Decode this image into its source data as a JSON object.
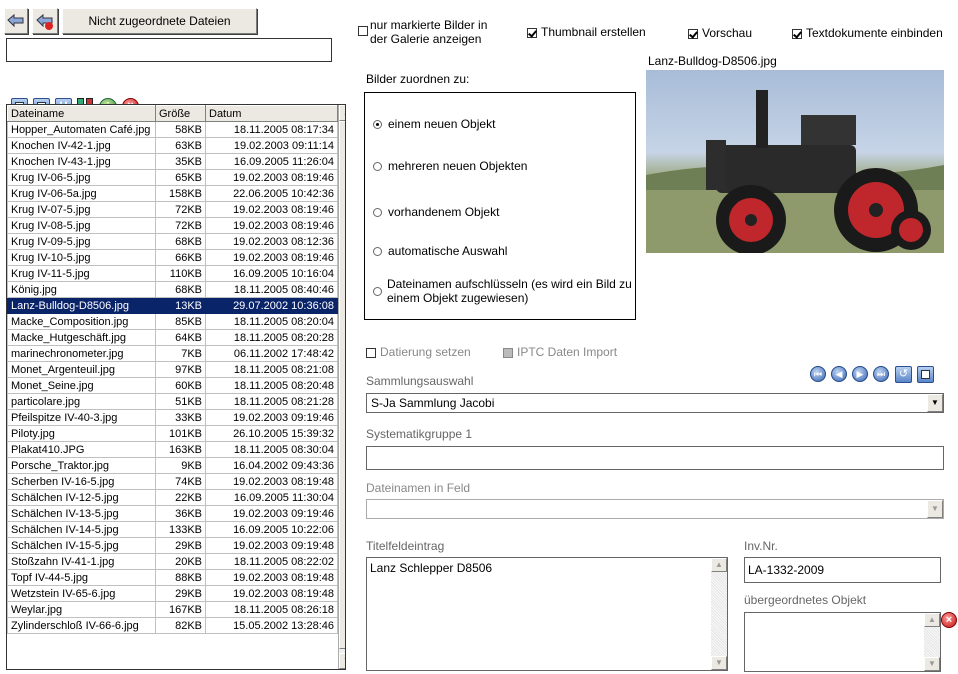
{
  "toolbar": {
    "unassigned_label": "Nicht zugeordnete Dateien",
    "filter_value": ""
  },
  "file_list": {
    "columns": [
      "Dateiname",
      "Größe",
      "Datum"
    ],
    "rows": [
      [
        "Hopper_Automaten Café.jpg",
        "58KB",
        "18.11.2005 08:17:34"
      ],
      [
        "Knochen IV-42-1.jpg",
        "63KB",
        "19.02.2003 09:11:14"
      ],
      [
        "Knochen IV-43-1.jpg",
        "35KB",
        "16.09.2005 11:26:04"
      ],
      [
        "Krug IV-06-5.jpg",
        "65KB",
        "19.02.2003 08:19:46"
      ],
      [
        "Krug IV-06-5a.jpg",
        "158KB",
        "22.06.2005 10:42:36"
      ],
      [
        "Krug IV-07-5.jpg",
        "72KB",
        "19.02.2003 08:19:46"
      ],
      [
        "Krug IV-08-5.jpg",
        "72KB",
        "19.02.2003 08:19:46"
      ],
      [
        "Krug IV-09-5.jpg",
        "68KB",
        "19.02.2003 08:12:36"
      ],
      [
        "Krug IV-10-5.jpg",
        "66KB",
        "19.02.2003 08:19:46"
      ],
      [
        "Krug IV-11-5.jpg",
        "110KB",
        "16.09.2005 10:16:04"
      ],
      [
        "König.jpg",
        "68KB",
        "18.11.2005 08:40:46"
      ],
      [
        "Lanz-Bulldog-D8506.jpg",
        "13KB",
        "29.07.2002 10:36:08"
      ],
      [
        "Macke_Composition.jpg",
        "85KB",
        "18.11.2005 08:20:04"
      ],
      [
        "Macke_Hutgeschäft.jpg",
        "64KB",
        "18.11.2005 08:20:28"
      ],
      [
        "marinechronometer.jpg",
        "7KB",
        "06.11.2002 17:48:42"
      ],
      [
        "Monet_Argenteuil.jpg",
        "97KB",
        "18.11.2005 08:21:08"
      ],
      [
        "Monet_Seine.jpg",
        "60KB",
        "18.11.2005 08:20:48"
      ],
      [
        "particolare.jpg",
        "51KB",
        "18.11.2005 08:21:28"
      ],
      [
        "Pfeilspitze IV-40-3.jpg",
        "33KB",
        "19.02.2003 09:19:46"
      ],
      [
        "Piloty.jpg",
        "101KB",
        "26.10.2005 15:39:32"
      ],
      [
        "Plakat410.JPG",
        "163KB",
        "18.11.2005 08:30:04"
      ],
      [
        "Porsche_Traktor.jpg",
        "9KB",
        "16.04.2002 09:43:36"
      ],
      [
        "Scherben IV-16-5.jpg",
        "74KB",
        "19.02.2003 08:19:48"
      ],
      [
        "Schälchen IV-12-5.jpg",
        "22KB",
        "16.09.2005 11:30:04"
      ],
      [
        "Schälchen IV-13-5.jpg",
        "36KB",
        "19.02.2003 09:19:46"
      ],
      [
        "Schälchen IV-14-5.jpg",
        "133KB",
        "16.09.2005 10:22:06"
      ],
      [
        "Schälchen IV-15-5.jpg",
        "29KB",
        "19.02.2003 09:19:48"
      ],
      [
        "Stoßzahn IV-41-1.jpg",
        "20KB",
        "18.11.2005 08:22:02"
      ],
      [
        "Topf IV-44-5.jpg",
        "88KB",
        "19.02.2003 08:19:48"
      ],
      [
        "Wetzstein IV-65-6.jpg",
        "29KB",
        "19.02.2003 08:19:48"
      ],
      [
        "Weylar.jpg",
        "167KB",
        "18.11.2005 08:26:18"
      ],
      [
        "Zylinderschloß IV-66-6.jpg",
        "82KB",
        "15.05.2002 13:28:46"
      ]
    ],
    "selected_index": 11
  },
  "options": {
    "only_marked_gallery": "nur markierte Bilder in der Galerie anzeigen",
    "thumbnail": "Thumbnail erstellen",
    "preview": "Vorschau",
    "text_docs": "Textdokumente einbinden"
  },
  "assign": {
    "label": "Bilder zuordnen zu:",
    "options": [
      "einem neuen Objekt",
      "mehreren neuen Objekten",
      "vorhandenem Objekt",
      "automatische Auswahl",
      "Dateinamen aufschlüsseln (es wird ein Bild zu einem Objekt zugewiesen)"
    ],
    "selected": 0
  },
  "preview": {
    "caption": "Lanz-Bulldog-D8506.jpg"
  },
  "dating": {
    "set_dating": "Datierung setzen",
    "iptc": "IPTC Daten Import"
  },
  "form": {
    "collection_label": "Sammlungsauswahl",
    "collection_value": "S-Ja  Sammlung Jacobi",
    "group_label": "Systematikgruppe 1",
    "group_value": "",
    "filename_field_label": "Dateinamen in Feld",
    "filename_field_value": "",
    "title_label": "Titelfeldeintrag",
    "title_value": "Lanz Schlepper D8506",
    "invnr_label": "Inv.Nr.",
    "invnr_value": "LA-1332-2009",
    "parent_label": "übergeordnetes Objekt",
    "parent_value": ""
  },
  "icons": {
    "back": "arrow-left-icon",
    "back2": "arrow-left-red-icon",
    "select_all": "check-all-icon",
    "deselect": "square-icon",
    "u": "u-icon",
    "grid": "grid-icon",
    "info": "info-icon",
    "delete": "delete-icon"
  }
}
